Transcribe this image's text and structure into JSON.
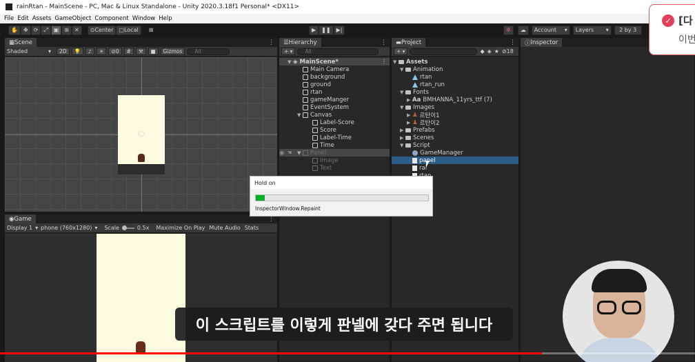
{
  "window": {
    "title": "rainRtan - MainScene - PC, Mac & Linux Standalone - Unity 2020.3.18f1 Personal* <DX11>"
  },
  "menu": [
    "File",
    "Edit",
    "Assets",
    "GameObject",
    "Component",
    "Window",
    "Help"
  ],
  "toolbar": {
    "center": "Center",
    "local": "Local",
    "account": "Account",
    "layers": "Layers",
    "layout": "2 by 3"
  },
  "scene": {
    "tab": "Scene",
    "shading": "Shaded",
    "mode_2d": "2D",
    "hidden_count": "0",
    "gizmos": "Gizmos",
    "search_placeholder": "All"
  },
  "game": {
    "tab": "Game",
    "display": "Display 1",
    "resolution": "phone (760x1280)",
    "scale_label": "Scale",
    "scale_value": "0.5x",
    "maximize": "Maximize On Play",
    "mute": "Mute Audio",
    "stats": "Stats"
  },
  "hierarchy": {
    "tab": "Hierarchy",
    "search_placeholder": "All",
    "scene_name": "MainScene*",
    "items": [
      {
        "label": "Main Camera",
        "depth": 1,
        "dim": false
      },
      {
        "label": "background",
        "depth": 1,
        "dim": false
      },
      {
        "label": "ground",
        "depth": 1,
        "dim": false
      },
      {
        "label": "rtan",
        "depth": 1,
        "dim": false
      },
      {
        "label": "gameManger",
        "depth": 1,
        "dim": false
      },
      {
        "label": "EventSystem",
        "depth": 1,
        "dim": false
      },
      {
        "label": "Canvas",
        "depth": 1,
        "dim": false,
        "expanded": true
      },
      {
        "label": "Label-Score",
        "depth": 2,
        "dim": false
      },
      {
        "label": "Score",
        "depth": 2,
        "dim": false
      },
      {
        "label": "Label-Time",
        "depth": 2,
        "dim": false
      },
      {
        "label": "Time",
        "depth": 2,
        "dim": false
      },
      {
        "label": "Panel",
        "depth": 1,
        "dim": true,
        "expanded": true
      },
      {
        "label": "Image",
        "depth": 2,
        "dim": true
      },
      {
        "label": "Text",
        "depth": 2,
        "dim": true
      }
    ]
  },
  "project": {
    "tab": "Project",
    "hidden_count": "18",
    "items": [
      {
        "label": "Assets",
        "depth": 0,
        "icon": "folder",
        "arrow": "▼",
        "bold": true
      },
      {
        "label": "Animation",
        "depth": 1,
        "icon": "folder",
        "arrow": "▼"
      },
      {
        "label": "rtan",
        "depth": 2,
        "icon": "anim",
        "arrow": ""
      },
      {
        "label": "rtan_run",
        "depth": 2,
        "icon": "anim",
        "arrow": ""
      },
      {
        "label": "Fonts",
        "depth": 1,
        "icon": "folder",
        "arrow": "▼"
      },
      {
        "label": "BMHANNA_11yrs_ttf (7)",
        "depth": 2,
        "icon": "font",
        "arrow": "▶"
      },
      {
        "label": "Images",
        "depth": 1,
        "icon": "folder",
        "arrow": "▼"
      },
      {
        "label": "르탄이1",
        "depth": 2,
        "icon": "sprite",
        "arrow": "▶"
      },
      {
        "label": "르탄이2",
        "depth": 2,
        "icon": "sprite",
        "arrow": "▶"
      },
      {
        "label": "Prefabs",
        "depth": 1,
        "icon": "folder",
        "arrow": "▶"
      },
      {
        "label": "Scenes",
        "depth": 1,
        "icon": "folder",
        "arrow": "▶"
      },
      {
        "label": "Script",
        "depth": 1,
        "icon": "folder",
        "arrow": "▼"
      },
      {
        "label": "GameManager",
        "depth": 2,
        "icon": "gear",
        "arrow": ""
      },
      {
        "label": "panel",
        "depth": 2,
        "icon": "script",
        "arrow": "",
        "selected": true
      },
      {
        "label": "rai",
        "depth": 2,
        "icon": "script",
        "arrow": ""
      },
      {
        "label": "rtan",
        "depth": 2,
        "icon": "script",
        "arrow": ""
      }
    ]
  },
  "inspector": {
    "tab": "Inspector"
  },
  "dialog": {
    "title": "Hold on",
    "message": "InspectorWindow.Repaint",
    "progress": 0.05
  },
  "toast": {
    "title_fragment": "[다",
    "body_fragment": "이번"
  },
  "subtitle": "이 스크립트를 이렇게 판넬에 갖다 주면 됩니다",
  "video": {
    "progress": 0.78
  },
  "colors": {
    "selection": "#2c5d87",
    "progress_green": "#06b025",
    "video_progress": "#ff0000",
    "toast_accent": "#e2405a",
    "game_bg": "#fefbe0"
  }
}
